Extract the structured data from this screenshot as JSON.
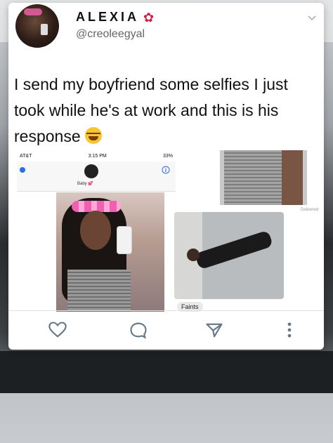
{
  "tweet": {
    "display_name": "ALEXIA",
    "handle": "@creoleegyal",
    "text": "I send my boyfriend some selfies I just took while he's at work and this is his response"
  },
  "screenshot": {
    "carrier": "AT&T",
    "time": "3:15 PM",
    "battery": "33%",
    "contact": "Baby 💕",
    "status": "Delivered",
    "reply": "Faints"
  },
  "icons": {
    "name_emoji": "hibiscus-icon",
    "text_emoji": "laughing-tears-icon",
    "menu": "chevron-down-icon",
    "actions": [
      "heart-icon",
      "reply-bubble-icon",
      "send-icon",
      "more-vertical-icon"
    ]
  },
  "colors": {
    "accent_blue": "#2b6fe6",
    "flower_red": "#d41e4a",
    "icon_gray": "#657786"
  }
}
